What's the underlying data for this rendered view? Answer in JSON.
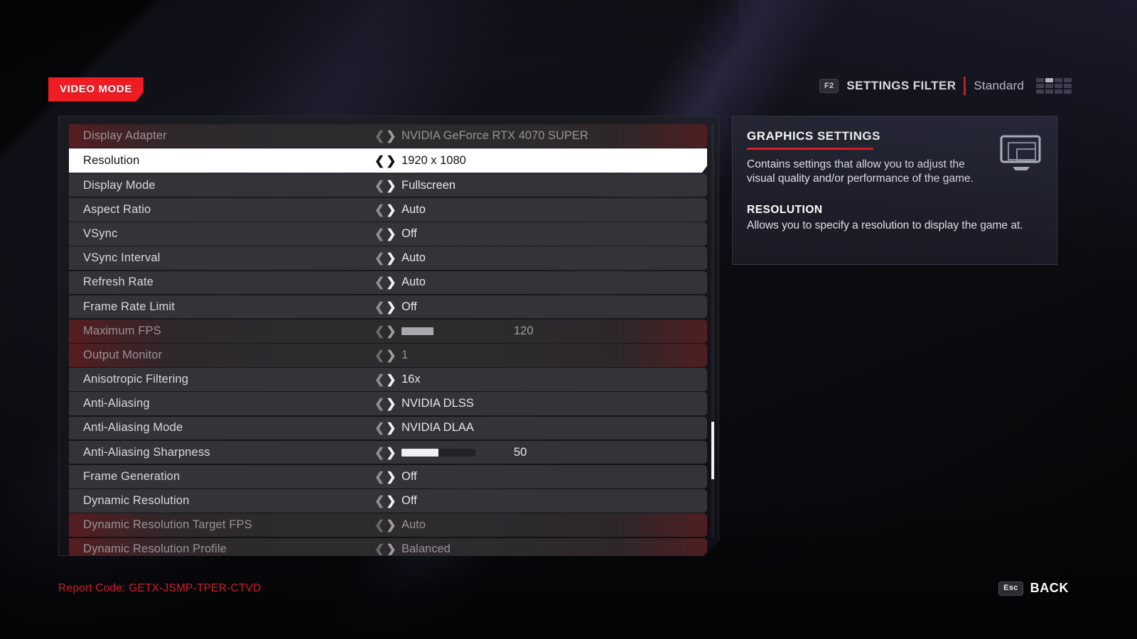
{
  "tab": {
    "label": "VIDEO MODE"
  },
  "header": {
    "filter_key": "F2",
    "filter_title": "SETTINGS FILTER",
    "filter_value": "Standard",
    "grid_icon": "grid-icon"
  },
  "settings": [
    {
      "label": "Display Adapter",
      "value": "NVIDIA GeForce RTX 4070 SUPER",
      "type": "option",
      "state": "disabled"
    },
    {
      "label": "Resolution",
      "value": "1920 x 1080",
      "type": "option",
      "state": "selected"
    },
    {
      "label": "Display Mode",
      "value": "Fullscreen",
      "type": "option",
      "state": "normal"
    },
    {
      "label": "Aspect Ratio",
      "value": "Auto",
      "type": "option",
      "state": "normal"
    },
    {
      "label": "VSync",
      "value": "Off",
      "type": "option",
      "state": "normal"
    },
    {
      "label": "VSync Interval",
      "value": "Auto",
      "type": "option",
      "state": "normal"
    },
    {
      "label": "Refresh Rate",
      "value": "Auto",
      "type": "option",
      "state": "normal"
    },
    {
      "label": "Frame Rate Limit",
      "value": "Off",
      "type": "option",
      "state": "normal"
    },
    {
      "label": "Maximum FPS",
      "value": "120",
      "type": "slider",
      "fill_percent": 43,
      "state": "disabled"
    },
    {
      "label": "Output Monitor",
      "value": "1",
      "type": "option",
      "state": "disabled"
    },
    {
      "label": "Anisotropic Filtering",
      "value": "16x",
      "type": "option",
      "state": "normal"
    },
    {
      "label": "Anti-Aliasing",
      "value": "NVIDIA DLSS",
      "type": "option",
      "state": "normal"
    },
    {
      "label": "Anti-Aliasing Mode",
      "value": "NVIDIA DLAA",
      "type": "option",
      "state": "normal"
    },
    {
      "label": "Anti-Aliasing Sharpness",
      "value": "50",
      "type": "slider",
      "fill_percent": 50,
      "state": "normal"
    },
    {
      "label": "Frame Generation",
      "value": "Off",
      "type": "option",
      "state": "normal"
    },
    {
      "label": "Dynamic Resolution",
      "value": "Off",
      "type": "option",
      "state": "normal"
    },
    {
      "label": "Dynamic Resolution Target FPS",
      "value": "Auto",
      "type": "option",
      "state": "disabled"
    },
    {
      "label": "Dynamic Resolution Profile",
      "value": "Balanced",
      "type": "option",
      "state": "disabled"
    }
  ],
  "arrows": {
    "left": "❮",
    "right": "❯"
  },
  "info": {
    "heading": "GRAPHICS SETTINGS",
    "description": "Contains settings that allow you to adjust the visual quality and/or performance of the game.",
    "sub_heading": "RESOLUTION",
    "sub_description": "Allows you to specify a resolution to display the game at.",
    "icon": "monitor-icon"
  },
  "footer": {
    "report_code": "Report Code: GETX-JSMP-TPER-CTVD",
    "back_key": "Esc",
    "back_label": "BACK"
  },
  "colors": {
    "accent_red": "#ef1c23",
    "selected_bg": "#ffffff",
    "row_bg": "#333338",
    "disabled_tint": "#701416"
  }
}
